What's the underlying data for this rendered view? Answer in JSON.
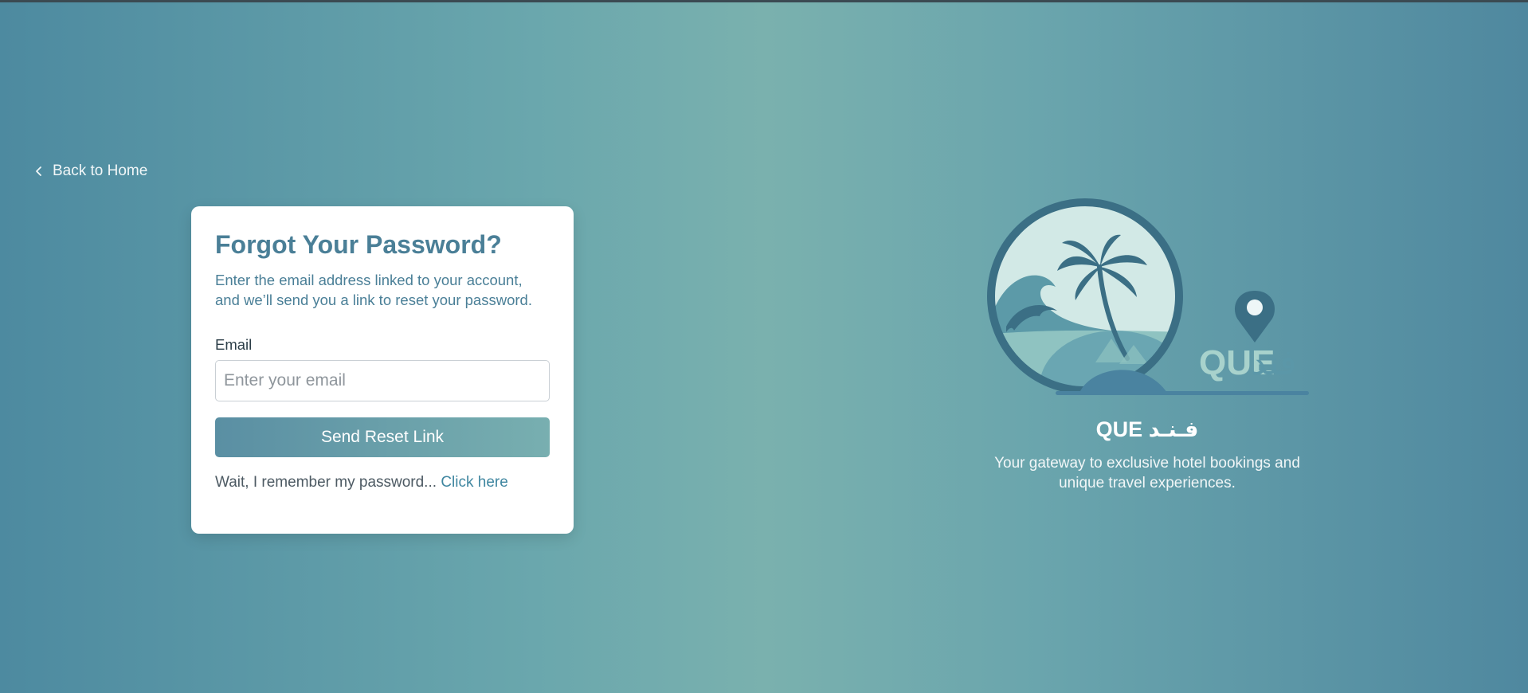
{
  "nav": {
    "back_label": "Back to Home"
  },
  "form": {
    "title": "Forgot Your Password?",
    "description": "Enter the email address linked to your account, and we’ll send you a link to reset your password.",
    "email_label": "Email",
    "email_placeholder": "Enter your email",
    "email_value": "",
    "submit_label": "Send Reset Link",
    "remember_text": "Wait, I remember my password...",
    "remember_link": "Click here"
  },
  "brand": {
    "logo_text_latin": "QUE",
    "logo_text_arabic": "فند",
    "name": "QUE فـنـد",
    "tagline": "Your gateway to exclusive hotel bookings and unique travel experiences."
  },
  "icons": {
    "back": "chevron-left-icon",
    "logo": "logo-icon",
    "palm": "palm-tree-icon",
    "dolphin": "dolphin-icon",
    "pin": "location-pin-icon"
  },
  "colors": {
    "primary": "#4a7f97",
    "button_start": "#5a8fa3",
    "button_end": "#78afb0",
    "link": "#3f86a0",
    "logo_dark": "#3b6f85",
    "logo_light": "#d2e9e6"
  }
}
